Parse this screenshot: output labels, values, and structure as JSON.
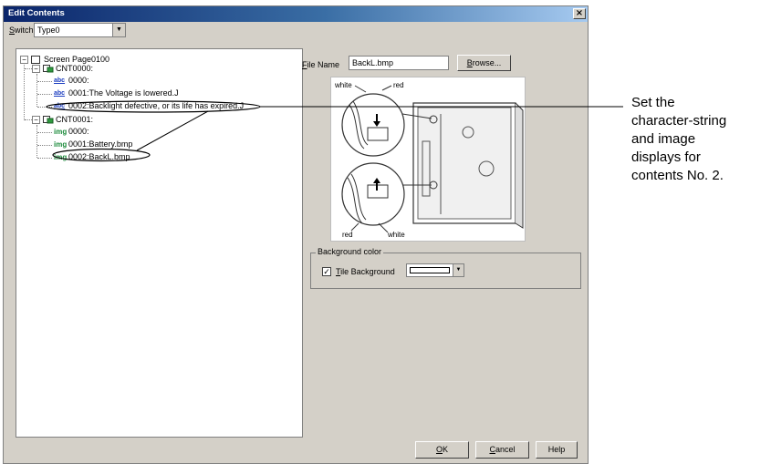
{
  "window": {
    "title": "Edit Contents",
    "close_glyph": "×"
  },
  "switch": {
    "label_key": "S",
    "label_rest": "witch",
    "value": "Type0",
    "arrow": "▼"
  },
  "tree": {
    "root": "Screen Page0100",
    "groups": [
      {
        "label": "CNT0000:",
        "items": [
          {
            "kind": "abc",
            "icon": "abc",
            "text": "0000:"
          },
          {
            "kind": "abc",
            "icon": "abc",
            "text": "0001:The Voltage is lowered.J"
          },
          {
            "kind": "abc",
            "icon": "abc",
            "text": "0002:Backlight defective, or its life has expired.J"
          }
        ]
      },
      {
        "label": "CNT0001:",
        "items": [
          {
            "kind": "image",
            "icon": "img",
            "text": "0000:"
          },
          {
            "kind": "image",
            "icon": "img",
            "text": "0001:Battery.bmp"
          },
          {
            "kind": "image",
            "icon": "img",
            "text": "0002:BackL.bmp"
          }
        ]
      }
    ]
  },
  "file": {
    "label_key": "F",
    "label_rest": "ile Name",
    "value": "BackL.bmp",
    "browse_key": "B",
    "browse_rest": "rowse..."
  },
  "preview": {
    "label_white_top": "white",
    "label_red_top": "red",
    "label_red_bottom": "red",
    "label_white_bottom": "white"
  },
  "background": {
    "group_label": "Background color",
    "check_key": "T",
    "check_rest": "ile Background",
    "checked": "☑"
  },
  "buttons": {
    "ok_key": "O",
    "ok_rest": "K",
    "cancel_key": "C",
    "cancel_rest": "ancel",
    "help": "Help"
  },
  "callout": {
    "lines": [
      "Set the",
      "character-string",
      "and image",
      "displays for",
      "contents No. 2."
    ]
  }
}
